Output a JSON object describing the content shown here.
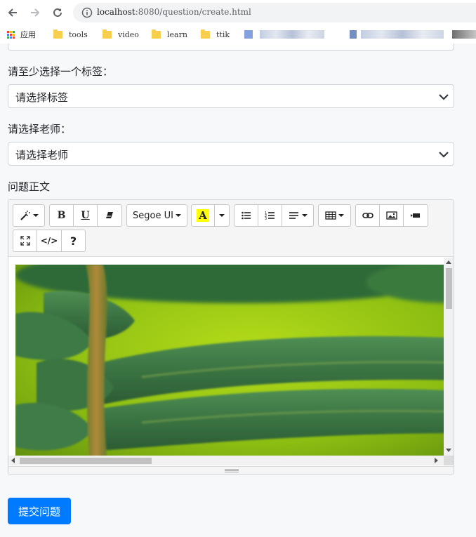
{
  "browser": {
    "url_host": "localhost",
    "url_rest": ":8080/question/create.html",
    "bookmarks": [
      {
        "label": "应用"
      },
      {
        "label": "tools"
      },
      {
        "label": "video"
      },
      {
        "label": "learn"
      },
      {
        "label": "ttik"
      }
    ]
  },
  "form": {
    "tag_label": "请至少选择一个标签：",
    "tag_select_value": "请选择标签",
    "teacher_label": "请选择老师：",
    "teacher_select_value": "请选择老师",
    "body_label": "问题正文",
    "editor": {
      "font_name": "Segoe UI",
      "bold": "B",
      "underline": "U",
      "codeview": "</>",
      "help": "?",
      "highlight_letter": "A"
    },
    "submit_label": "提交问题"
  },
  "colors": {
    "primary": "#007bff",
    "highlight": "#ffff00"
  }
}
